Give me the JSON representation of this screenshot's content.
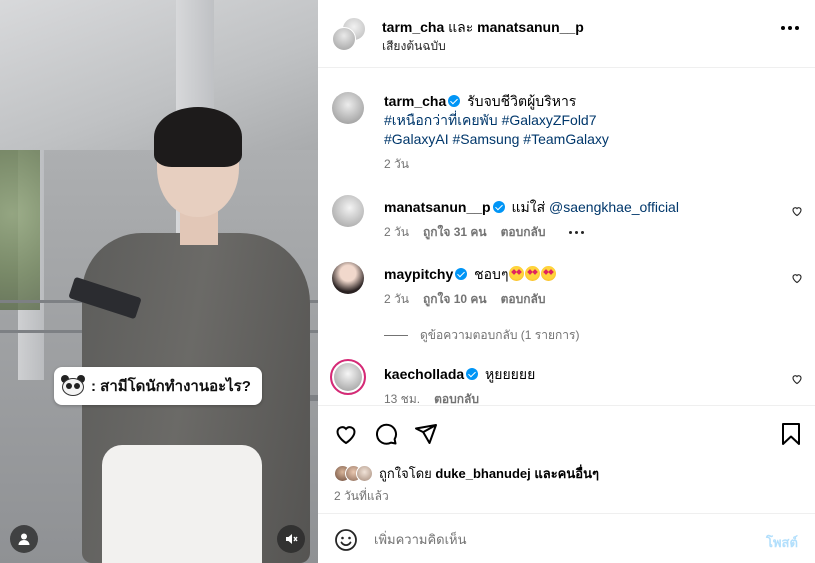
{
  "media": {
    "caption_text": ": สามีโดนักทำงานอะไร?",
    "icons": {
      "user": "user-icon",
      "mute": "speaker-muted-icon",
      "panda": "panda-emoji"
    }
  },
  "header": {
    "user1": "tarm_cha",
    "separator": "และ",
    "user2": "manatsanun__p",
    "audio": "เสียงต้นฉบับ",
    "menu_icon": "more-options-icon"
  },
  "comments": [
    {
      "username": "tarm_cha",
      "verified": true,
      "text": "รับจบชีวิตผู้บริหาร",
      "hashtags_line1": "#เหนือกว่าที่เคยพับ #GalaxyZFold7",
      "hashtags_line2": "#GalaxyAI #Samsung #TeamGalaxy",
      "time": "2 วัน"
    },
    {
      "username": "manatsanun__p",
      "verified": true,
      "text": "แม่ใส่",
      "mention": "@saengkhae_official",
      "time": "2 วัน",
      "likes": "ถูกใจ 31 คน",
      "reply": "ตอบกลับ"
    },
    {
      "username": "maypitchy",
      "verified": true,
      "text": "ชอบๆ",
      "time": "2 วัน",
      "likes": "ถูกใจ 10 คน",
      "reply": "ตอบกลับ",
      "view_replies": "ดูข้อความตอบกลับ (1 รายการ)"
    },
    {
      "username": "kaechollada",
      "verified": true,
      "text": "หูยยยยย",
      "time": "13 ชม.",
      "reply": "ตอบกลับ"
    }
  ],
  "actions": {
    "liked_by_prefix": "ถูกใจโดย",
    "liked_by_user": "duke_bhanudej",
    "liked_by_suffix": "และคนอื่นๆ",
    "posted_ago": "2 วันที่แล้ว"
  },
  "composer": {
    "placeholder": "เพิ่มความคิดเห็น",
    "post_label": "โพสต์"
  },
  "colors": {
    "verified": "#0095f6",
    "link": "#00376b",
    "muted_text": "#737373",
    "post_button": "#b2dffc",
    "story_ring": "#d62976"
  }
}
